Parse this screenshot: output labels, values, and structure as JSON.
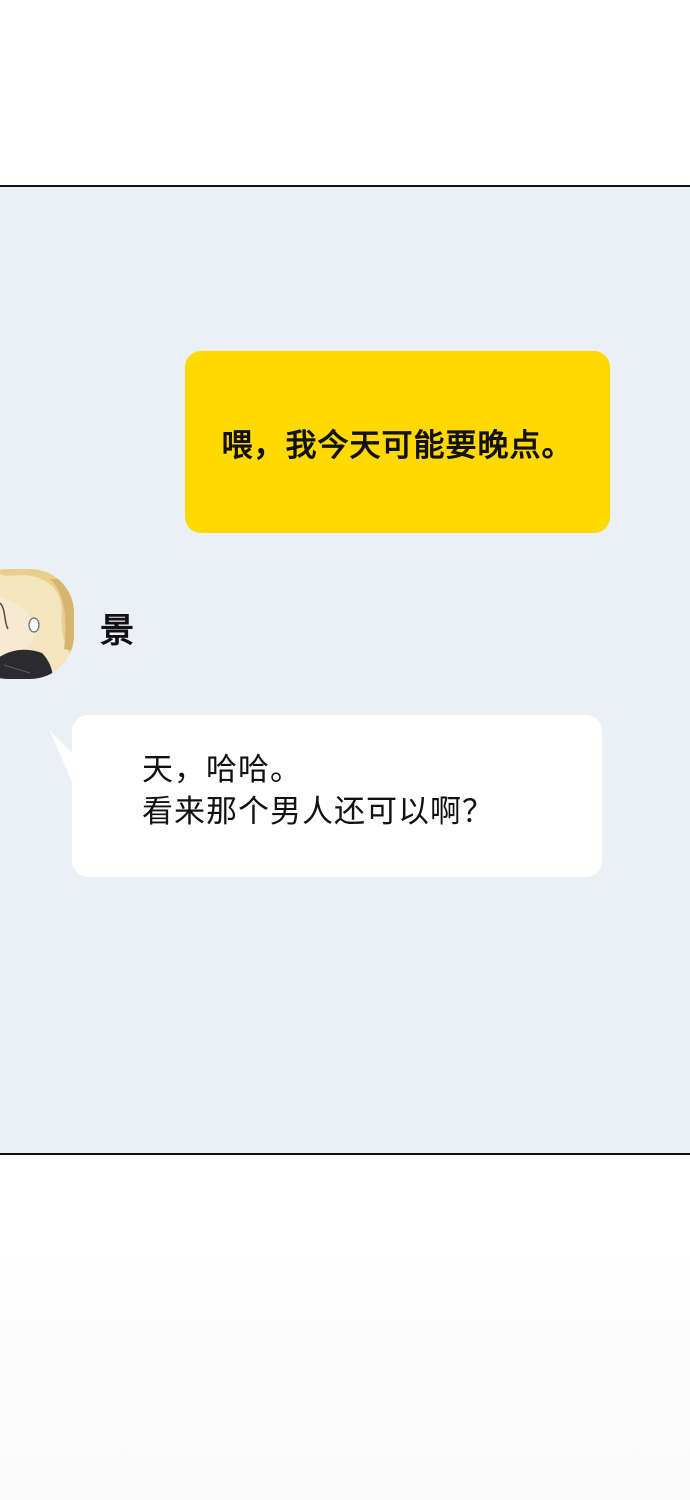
{
  "chat": {
    "outgoing_message": "喂，我今天可能要晚点。",
    "contact_name": "景",
    "incoming_message": {
      "line1": "天，哈哈。",
      "line2": "看来那个男人还可以啊？"
    }
  },
  "colors": {
    "chat_background": "#ebf0f5",
    "outgoing_bubble": "#ffd900",
    "incoming_bubble": "#ffffff",
    "panel_border": "#111111"
  },
  "icons": {
    "avatar": "contact-avatar-illustration"
  }
}
